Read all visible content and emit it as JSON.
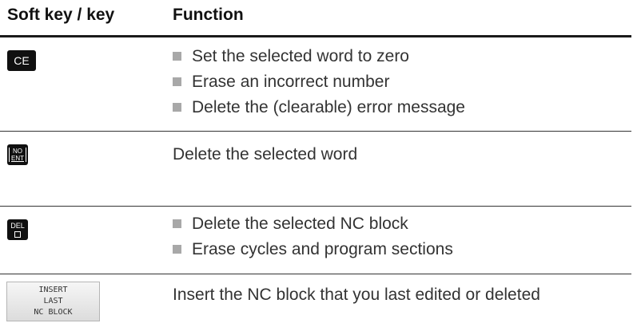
{
  "header": {
    "key_col": "Soft key / key",
    "func_col": "Function"
  },
  "rows": [
    {
      "key": {
        "type": "keycap",
        "icon": "ce-key-icon",
        "label": "CE"
      },
      "bullets": [
        "Set the selected word to zero",
        "Erase an incorrect number",
        "Delete the (clearable) error message"
      ]
    },
    {
      "key": {
        "type": "keycap",
        "icon": "no-ent-key-icon",
        "line1": "NO",
        "line2": "ENT"
      },
      "text": "Delete the selected word"
    },
    {
      "key": {
        "type": "keycap",
        "icon": "del-key-icon",
        "label": "DEL"
      },
      "bullets": [
        "Delete the selected NC block",
        "Erase cycles and program sections"
      ]
    },
    {
      "key": {
        "type": "softkey",
        "lines": [
          "INSERT",
          "LAST",
          "NC BLOCK"
        ]
      },
      "text": "Insert the NC block that you last edited or deleted"
    }
  ]
}
